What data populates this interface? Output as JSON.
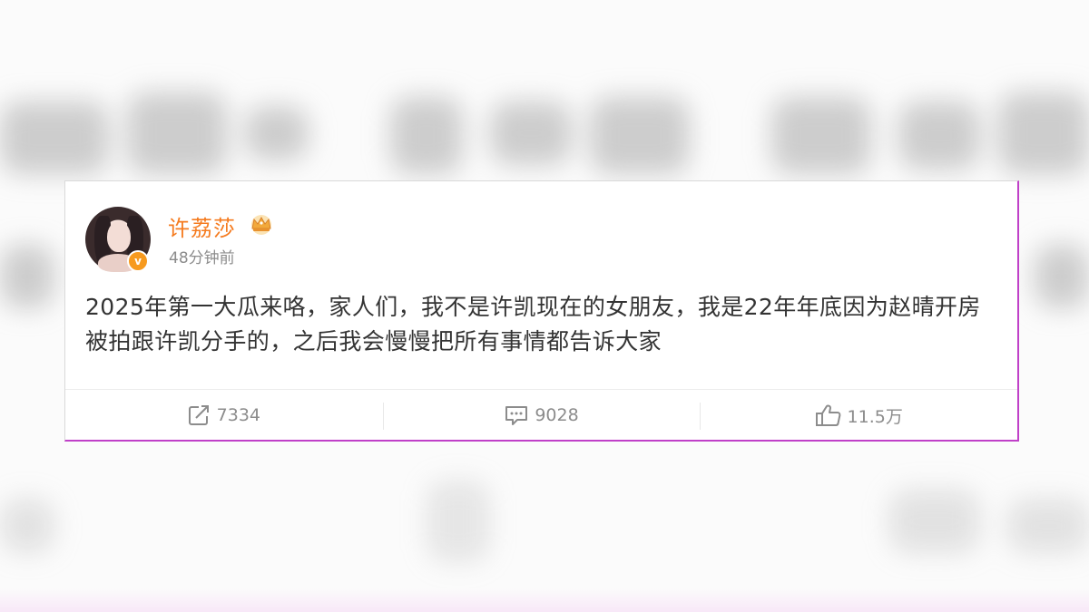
{
  "post": {
    "username": "许荔莎",
    "time": "48分钟前",
    "content": "2025年第一大瓜来咯，家人们，我不是许凯现在的女朋友，我是22年年底因为赵晴开房被拍跟许凯分手的，之后我会慢慢把所有事情都告诉大家",
    "verified_icon": "verified-v-icon",
    "badge_icon": "crown-icon"
  },
  "actions": {
    "repost_count": "7334",
    "comment_count": "9028",
    "like_count": "11.5万"
  },
  "colors": {
    "username": "#f57b1f",
    "verified": "#f79a1e",
    "text": "#333333",
    "muted": "#8c8c8c",
    "frame_accent": "#c040c8"
  }
}
